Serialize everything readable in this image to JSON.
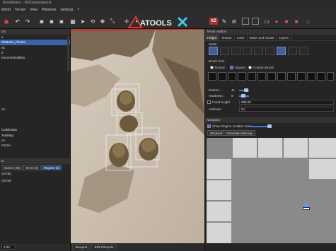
{
  "window": {
    "title": "WorldEditor - W0Cleanedworld"
  },
  "menu": [
    "World",
    "Terrain",
    "View",
    "Windows",
    "Settings",
    "?"
  ],
  "logo_text": "ATOOLS",
  "toolbar": {
    "icons": [
      "save-icon",
      "undo-icon",
      "redo-icon",
      "camera-icon",
      "camera-icon",
      "camera-icon",
      "grid-icon",
      "cursor-icon",
      "rotate-icon",
      "move-icon",
      "scale-icon",
      "terrain-icon",
      "dot-icon",
      "xz-icon",
      "paint-icon",
      "hide-icon",
      "square-icon",
      "square-icon",
      "box-icon",
      "sphere-icon",
      "cube-icon",
      "cube-icon",
      "fire-icon"
    ],
    "xz_label": "XZ"
  },
  "left_panel": {
    "header": "cts",
    "tree": [
      "e",
      "ShMaloe_Pilar01",
      "nk",
      "d",
      "heromesbubbles",
      "",
      "",
      "",
      "",
      "",
      "",
      "",
      "",
      "",
      "on",
      "",
      "",
      "",
      "GuildClash",
      "TestMap",
      "no",
      "nZone"
    ],
    "selected_index": 1,
    "lower_header": "ts",
    "tabs": [
      "Movers (95)",
      "Items (0)",
      "Regions (2)"
    ],
    "active_tab": 2,
    "regions": [
      "(ID:05)",
      "(ID:04)"
    ],
    "status_value": "3,00"
  },
  "viewport_tabs": [
    "Viewport",
    "Edit Teleports"
  ],
  "terrain_panel": {
    "header": "Terrain edition",
    "tabs": [
      "Height",
      "Texture",
      "Color",
      "Water and clouds",
      "Layers"
    ],
    "active_tab": 0,
    "mode_label": "Mode",
    "brush_form_label": "Brush form",
    "round_label": "Round",
    "square_label": "Square",
    "custom_label": "Custom Brush",
    "radius_label": "Radius :",
    "radius_value": "41",
    "hardness_label": "Hardness :",
    "hardness_value": "9",
    "fixed_height_label": "Fixed height",
    "fixed_height_value": "999,00",
    "attribute_label": "Attribute :",
    "attribute_value": "No"
  },
  "navigator": {
    "header": "Navigator",
    "show_region_icons": "Show Region Icons",
    "icon_size_label": "Icon Size:",
    "reload_button": "(Re)load",
    "generate_button": "Generate Minimap"
  },
  "colors": {
    "accent": "#3a64a8",
    "active_tool": "#b03030",
    "panel_bg": "#252526"
  }
}
